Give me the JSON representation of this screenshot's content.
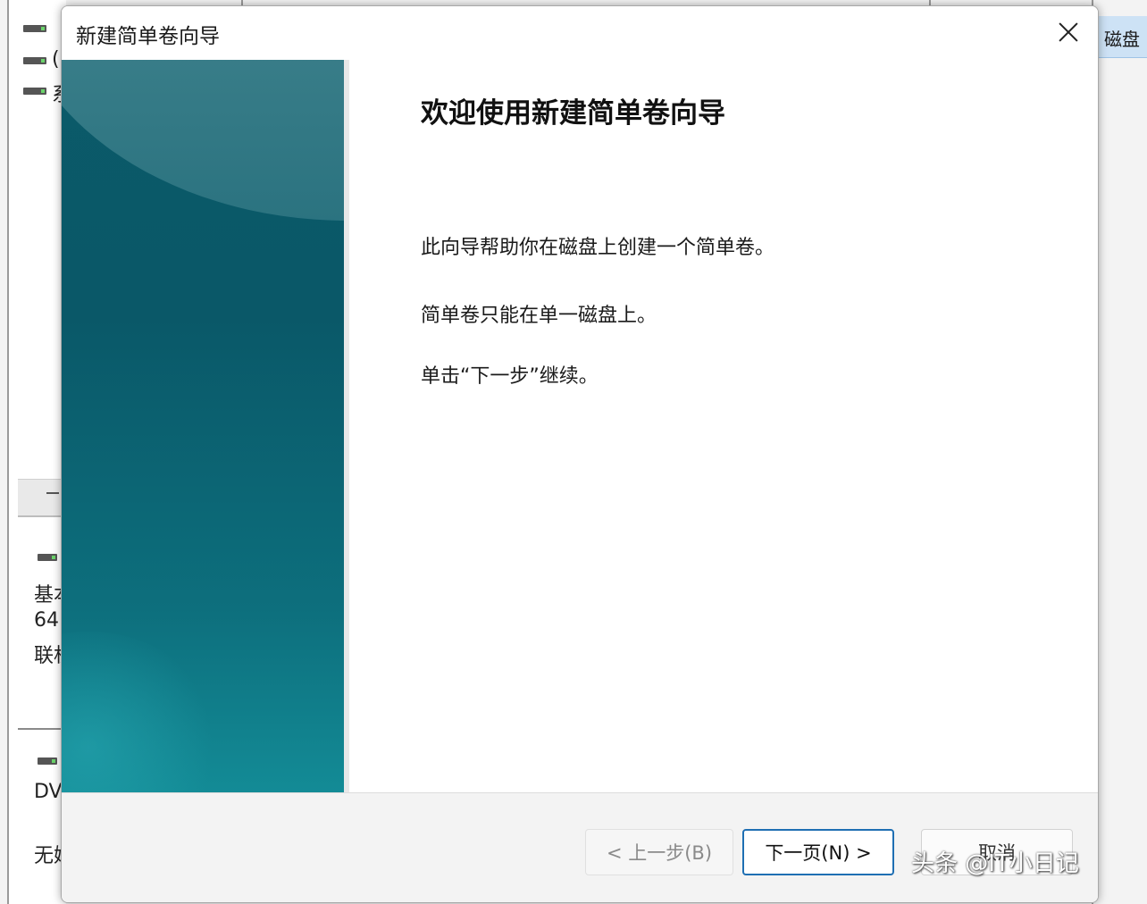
{
  "background": {
    "action_pane_label": "磁盘",
    "list_fragments": [
      "(",
      "系"
    ],
    "disk_fragments": [
      "基本",
      "64",
      "联机"
    ],
    "dvd_fragments": [
      "DV",
      "无媒"
    ]
  },
  "dialog": {
    "title": "新建简单卷向导",
    "heading": "欢迎使用新建简单卷向导",
    "paragraphs": [
      "此向导帮助你在磁盘上创建一个简单卷。",
      "简单卷只能在单一磁盘上。",
      "单击“下一步”继续。"
    ],
    "buttons": {
      "back": "< 上一步(B)",
      "next": "下一页(N) >",
      "cancel": "取消"
    }
  },
  "watermark": "头条 @IT小日记",
  "colors": {
    "banner_dark": "#0a5868",
    "banner_light": "#138b96",
    "primary_border": "#1f6fb3"
  }
}
